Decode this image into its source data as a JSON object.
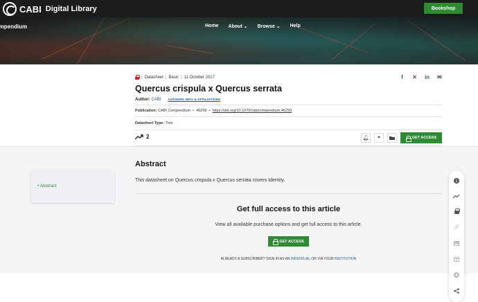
{
  "header": {
    "brand": "CABI",
    "brand_sub": "Digital Library",
    "bookshop_label": "Bookshop"
  },
  "hero": {
    "section_title": "Compendium",
    "nav": [
      {
        "label": "Home"
      },
      {
        "label": "About ⌄"
      },
      {
        "label": "Browse ⌄"
      },
      {
        "label": "Help"
      }
    ]
  },
  "article": {
    "type": "Datasheet",
    "level": "Basic",
    "date": "11 October 2017",
    "title": "Quercus crispula x Quercus serrata",
    "author_label": "Author:",
    "author": "CABI",
    "affiliations_label": "AUTHORS INFO & AFFILIATIONS",
    "publication_label": "Publication:",
    "publication": "CABI Compendium",
    "publication_number": "46299",
    "doi": "https://doi.org/10.1079/cabicompendium.46299",
    "datasheet_type_label": "Datasheet Type:",
    "datasheet_type": "Tree",
    "metric_count": "2",
    "get_access_label": "GET ACCESS"
  },
  "share_icons": [
    "facebook-icon",
    "x-icon",
    "linkedin-icon",
    "email-icon"
  ],
  "toc": {
    "items": [
      {
        "label": "Abstract"
      }
    ]
  },
  "abstract": {
    "heading": "Abstract",
    "text": "This datasheet on Quercus crispula x Quercus serrata covers Identity."
  },
  "access": {
    "heading": "Get full access to this article",
    "text": "View all available purchase options and get full access to this article.",
    "button_label": "GET ACCESS",
    "subscriber_prefix": "ALREADY A SUBSCRIBER? SIGN IN AS AN",
    "individual": "INDIVIDUAL",
    "or_via": "OR VIA YOUR",
    "institution": "INSTITUTION"
  },
  "colors": {
    "accent_green": "#2f8a34",
    "link_blue": "#0b5aa8",
    "lock_red": "#c0232b"
  }
}
